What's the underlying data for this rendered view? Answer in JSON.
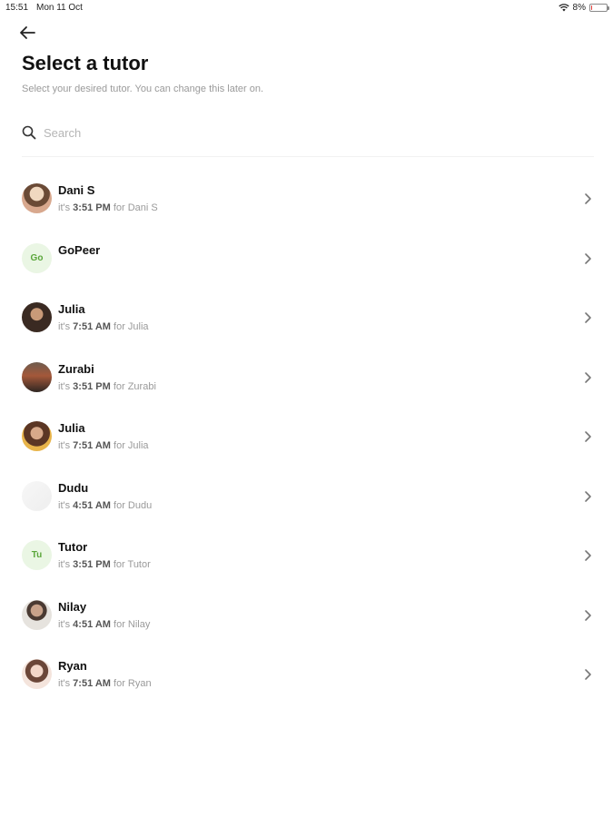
{
  "status_bar": {
    "time": "15:51",
    "date": "Mon 11 Oct",
    "battery": "8%",
    "battery_level": 0.08,
    "icons": [
      "wifi-icon",
      "battery-icon"
    ]
  },
  "header": {
    "back_icon": "arrow-left-icon",
    "title": "Select a tutor",
    "subtitle": "Select your desired tutor. You can change this later on."
  },
  "search": {
    "icon": "search-icon",
    "placeholder": "Search",
    "value": ""
  },
  "tutors": [
    {
      "name": "Dani S",
      "avatar": "photo",
      "prefix": "it's",
      "time": "3:51 PM",
      "suffix": "for Dani S"
    },
    {
      "name": "GoPeer",
      "avatar": "initials",
      "initials": "Go",
      "prefix": "",
      "time": "",
      "suffix": ""
    },
    {
      "name": "Julia",
      "avatar": "photo",
      "prefix": "it's",
      "time": "7:51 AM",
      "suffix": "for Julia"
    },
    {
      "name": "Zurabi",
      "avatar": "photo",
      "prefix": "it's",
      "time": "3:51 PM",
      "suffix": "for Zurabi"
    },
    {
      "name": "Julia",
      "avatar": "photo",
      "prefix": "it's",
      "time": "7:51 AM",
      "suffix": "for Julia"
    },
    {
      "name": "Dudu",
      "avatar": "photo",
      "prefix": "it's",
      "time": "4:51 AM",
      "suffix": "for Dudu"
    },
    {
      "name": "Tutor",
      "avatar": "initials",
      "initials": "Tu",
      "prefix": "it's",
      "time": "3:51 PM",
      "suffix": "for Tutor"
    },
    {
      "name": "Nilay",
      "avatar": "photo",
      "prefix": "it's",
      "time": "4:51 AM",
      "suffix": "for Nilay"
    },
    {
      "name": "Ryan",
      "avatar": "photo",
      "prefix": "it's",
      "time": "7:51 AM",
      "suffix": "for Ryan"
    }
  ],
  "colors": {
    "accent_green": "#5aa63a",
    "battery_low": "#e53935"
  }
}
